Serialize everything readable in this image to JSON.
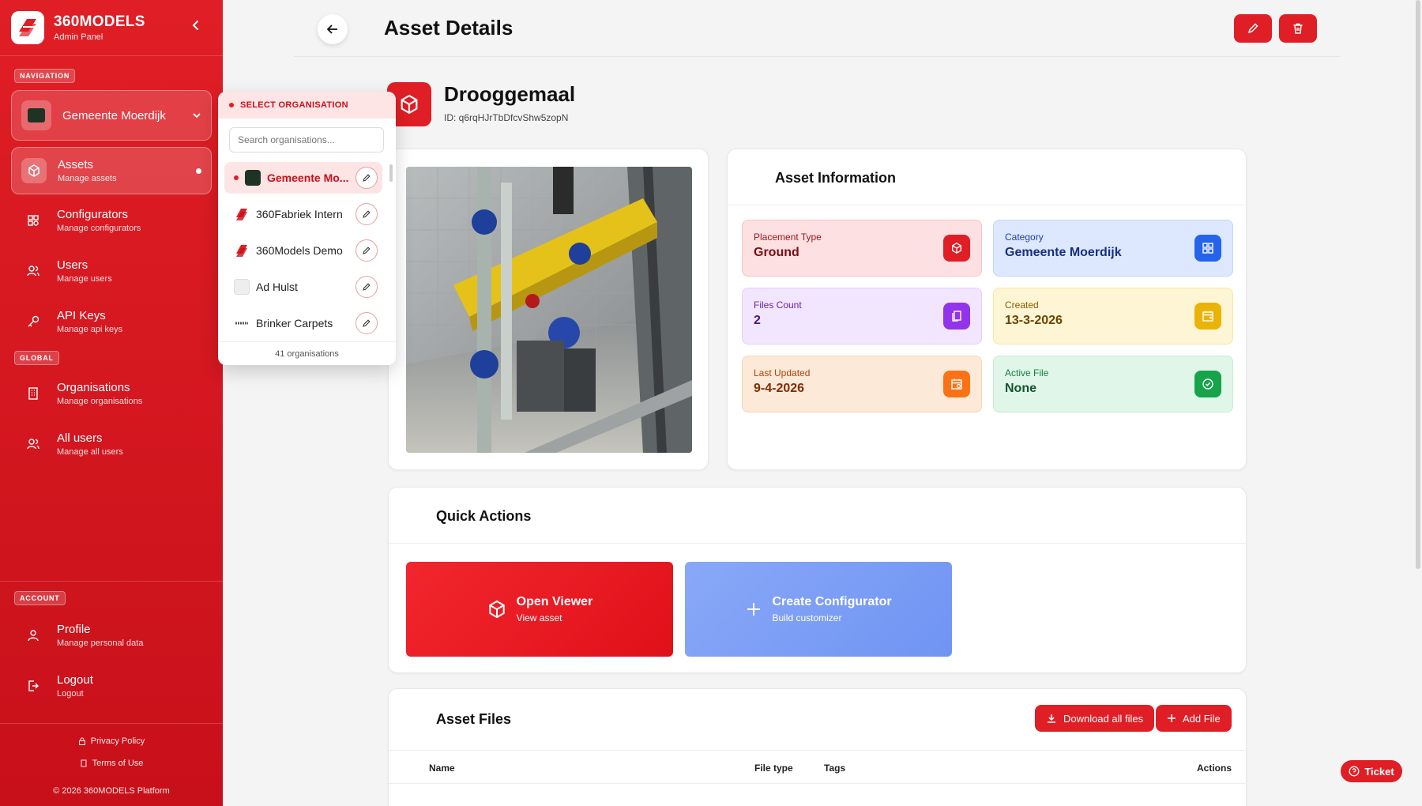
{
  "brand": {
    "name": "360MODELS",
    "subtitle": "Admin Panel"
  },
  "sidebar": {
    "navigation_label": "NAVIGATION",
    "org_selector": {
      "selected": "Gemeente Moerdijk"
    },
    "nav_items": [
      {
        "label": "Assets",
        "sub": "Manage assets",
        "icon": "cube-icon",
        "active": true
      },
      {
        "label": "Configurators",
        "sub": "Manage configurators",
        "icon": "grid-icon"
      },
      {
        "label": "Users",
        "sub": "Manage users",
        "icon": "users-icon"
      },
      {
        "label": "API Keys",
        "sub": "Manage api keys",
        "icon": "key-icon"
      }
    ],
    "global_label": "GLOBAL",
    "global_items": [
      {
        "label": "Organisations",
        "sub": "Manage organisations",
        "icon": "building-icon"
      },
      {
        "label": "All users",
        "sub": "Manage all users",
        "icon": "users-icon"
      }
    ],
    "account_label": "ACCOUNT",
    "account_items": [
      {
        "label": "Profile",
        "sub": "Manage personal data",
        "icon": "user-icon"
      },
      {
        "label": "Logout",
        "sub": "Logout",
        "icon": "logout-icon"
      }
    ],
    "footer": {
      "privacy": "Privacy Policy",
      "terms": "Terms of Use",
      "copyright": "© 2026 360MODELS Platform"
    }
  },
  "org_dropdown": {
    "title": "SELECT ORGANISATION",
    "search_placeholder": "Search organisations...",
    "items": [
      {
        "name": "Gemeente Mo...",
        "selected": true
      },
      {
        "name": "360Fabriek Intern"
      },
      {
        "name": "360Models Demo"
      },
      {
        "name": "Ad Hulst"
      },
      {
        "name": "Brinker Carpets"
      }
    ],
    "count": "41 organisations"
  },
  "header": {
    "title": "Asset Details"
  },
  "asset": {
    "name": "Drooggemaal",
    "id_text": "ID: q6rqHJrTbDfcvShw5zopN"
  },
  "asset_info": {
    "title": "Asset Information",
    "tiles": [
      {
        "label": "Placement Type",
        "value": "Ground",
        "icon": "cube-icon"
      },
      {
        "label": "Category",
        "value": "Gemeente Moerdijk",
        "icon": "grid-icon"
      },
      {
        "label": "Files Count",
        "value": "2",
        "icon": "files-icon"
      },
      {
        "label": "Created",
        "value": "13-3-2026",
        "icon": "calendar-plus-icon"
      },
      {
        "label": "Last Updated",
        "value": "9-4-2026",
        "icon": "calendar-clock-icon"
      },
      {
        "label": "Active File",
        "value": "None",
        "icon": "check-circle-icon"
      }
    ]
  },
  "quick_actions": {
    "title": "Quick Actions",
    "open_viewer": {
      "label": "Open Viewer",
      "sub": "View asset"
    },
    "create_configurator": {
      "label": "Create Configurator",
      "sub": "Build customizer"
    }
  },
  "asset_files": {
    "title": "Asset Files",
    "download_all": "Download all files",
    "add_file": "Add File",
    "columns": [
      "Name",
      "File type",
      "Tags",
      "Actions"
    ]
  },
  "ticket": "Ticket",
  "colors": {
    "primary": "#e01e25",
    "sidebar": "#d3151e",
    "viewer_blue": "#7b9ff5"
  }
}
